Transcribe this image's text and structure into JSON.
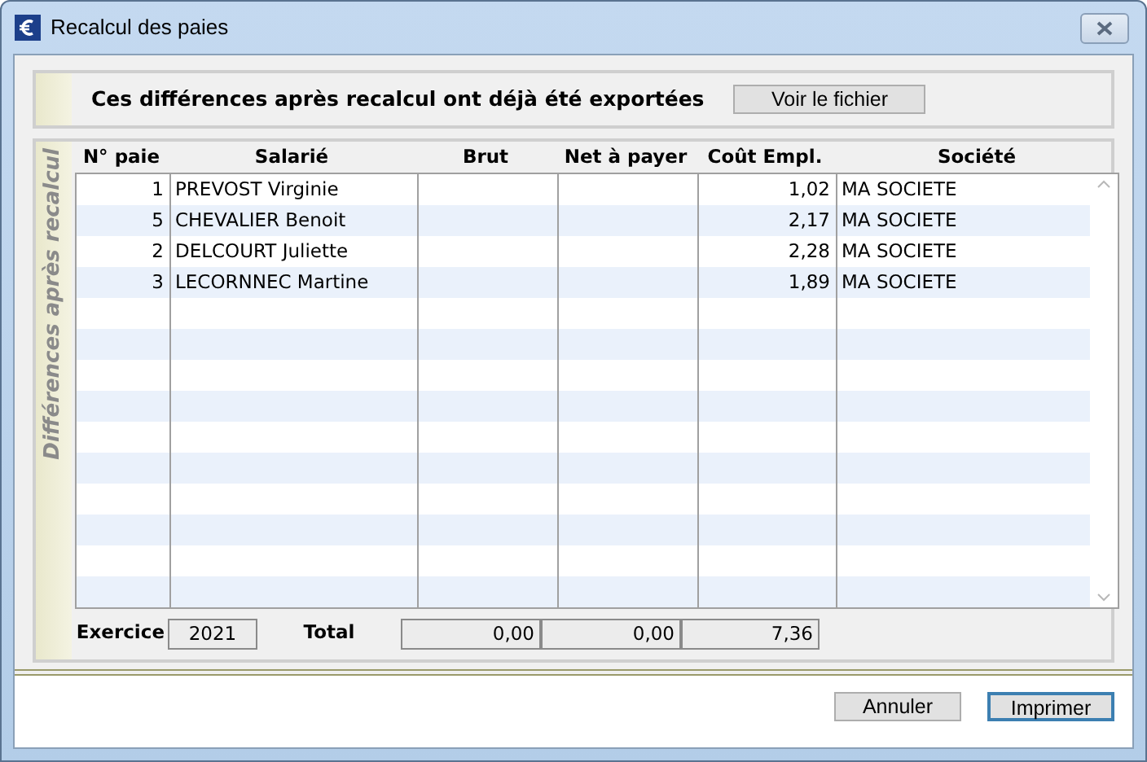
{
  "window": {
    "title": "Recalcul des paies"
  },
  "notice": {
    "text": "Ces différences après recalcul ont déjà été exportées",
    "button": "Voir le fichier"
  },
  "grid": {
    "side_label": "Différences après recalcul",
    "columns": [
      "N° paie",
      "Salarié",
      "Brut",
      "Net à payer",
      "Coût Empl.",
      "Société"
    ],
    "rows": [
      {
        "number": "1",
        "employee": "PREVOST Virginie",
        "employer_cost": "1,02",
        "company": "MA SOCIETE"
      },
      {
        "number": "5",
        "employee": "CHEVALIER Benoit",
        "employer_cost": "2,17",
        "company": "MA SOCIETE"
      },
      {
        "number": "2",
        "employee": "DELCOURT Juliette",
        "employer_cost": "2,28",
        "company": "MA SOCIETE"
      },
      {
        "number": "3",
        "employee": "LECORNNEC Martine",
        "employer_cost": "1,89",
        "company": "MA SOCIETE"
      }
    ]
  },
  "footer": {
    "year_label": "Exercice",
    "year": "2021",
    "total_label": "Total",
    "totals": [
      "0,00",
      "0,00",
      "7,36"
    ]
  },
  "buttons": [
    {
      "label": "Annuler",
      "default": false
    },
    {
      "label": "Imprimer",
      "default": true
    }
  ]
}
